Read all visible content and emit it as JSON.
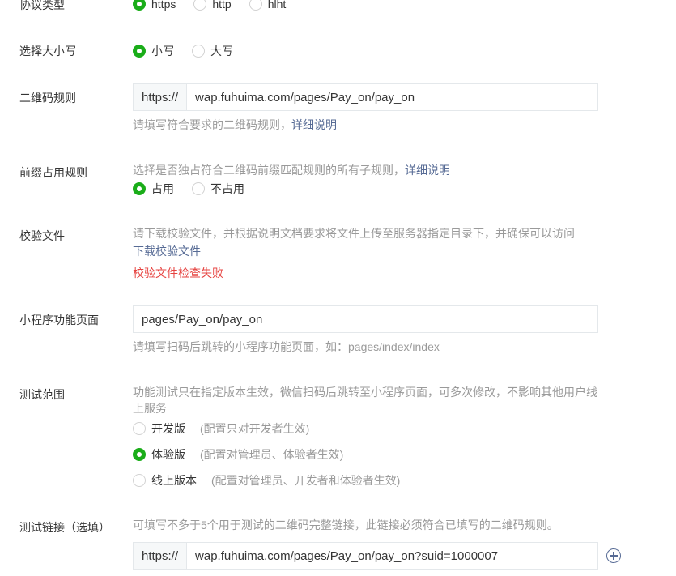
{
  "protocol": {
    "label": "协议类型",
    "options": [
      "https",
      "http",
      "hlht"
    ],
    "selected": 0
  },
  "case": {
    "label": "选择大小写",
    "options": [
      "小写",
      "大写"
    ],
    "selected": 0
  },
  "qr_rule": {
    "label": "二维码规则",
    "prefix": "https://",
    "value": "wap.fuhuima.com/pages/Pay_on/pay_on",
    "hint": "请填写符合要求的二维码规则，",
    "hint_link": "详细说明"
  },
  "prefix_rule": {
    "label": "前缀占用规则",
    "hint": "选择是否独占符合二维码前缀匹配规则的所有子规则，",
    "hint_link": "详细说明",
    "options": [
      "占用",
      "不占用"
    ],
    "selected": 0
  },
  "verify_file": {
    "label": "校验文件",
    "hint": "请下载校验文件，并根据说明文档要求将文件上传至服务器指定目录下，并确保可以访问",
    "download_link": "下载校验文件",
    "error": "校验文件检查失败"
  },
  "mini_page": {
    "label": "小程序功能页面",
    "value": "pages/Pay_on/pay_on",
    "hint": "请填写扫码后跳转的小程序功能页面，如：pages/index/index"
  },
  "test_scope": {
    "label": "测试范围",
    "hint_line1": "功能测试只在指定版本生效，微信扫码后跳转至小程序页面，可多次修改，不影响其他用户线",
    "hint_line2": "上服务",
    "options": [
      {
        "label": "开发版",
        "note": "(配置只对开发者生效)"
      },
      {
        "label": "体验版",
        "note": "(配置对管理员、体验者生效)"
      },
      {
        "label": "线上版本",
        "note": "(配置对管理员、开发者和体验者生效)"
      }
    ],
    "selected": 1
  },
  "test_link": {
    "label": "测试链接（选填）",
    "hint": "可填写不多于5个用于测试的二维码完整链接，此链接必须符合已填写的二维码规则。",
    "prefix": "https://",
    "value": "wap.fuhuima.com/pages/Pay_on/pay_on?suid=1000007"
  },
  "icons": {
    "add": "plus-circle-icon"
  },
  "colors": {
    "accent": "#1aad19",
    "link": "#576b95",
    "error": "#e64340",
    "hint": "#9a9a9a"
  }
}
